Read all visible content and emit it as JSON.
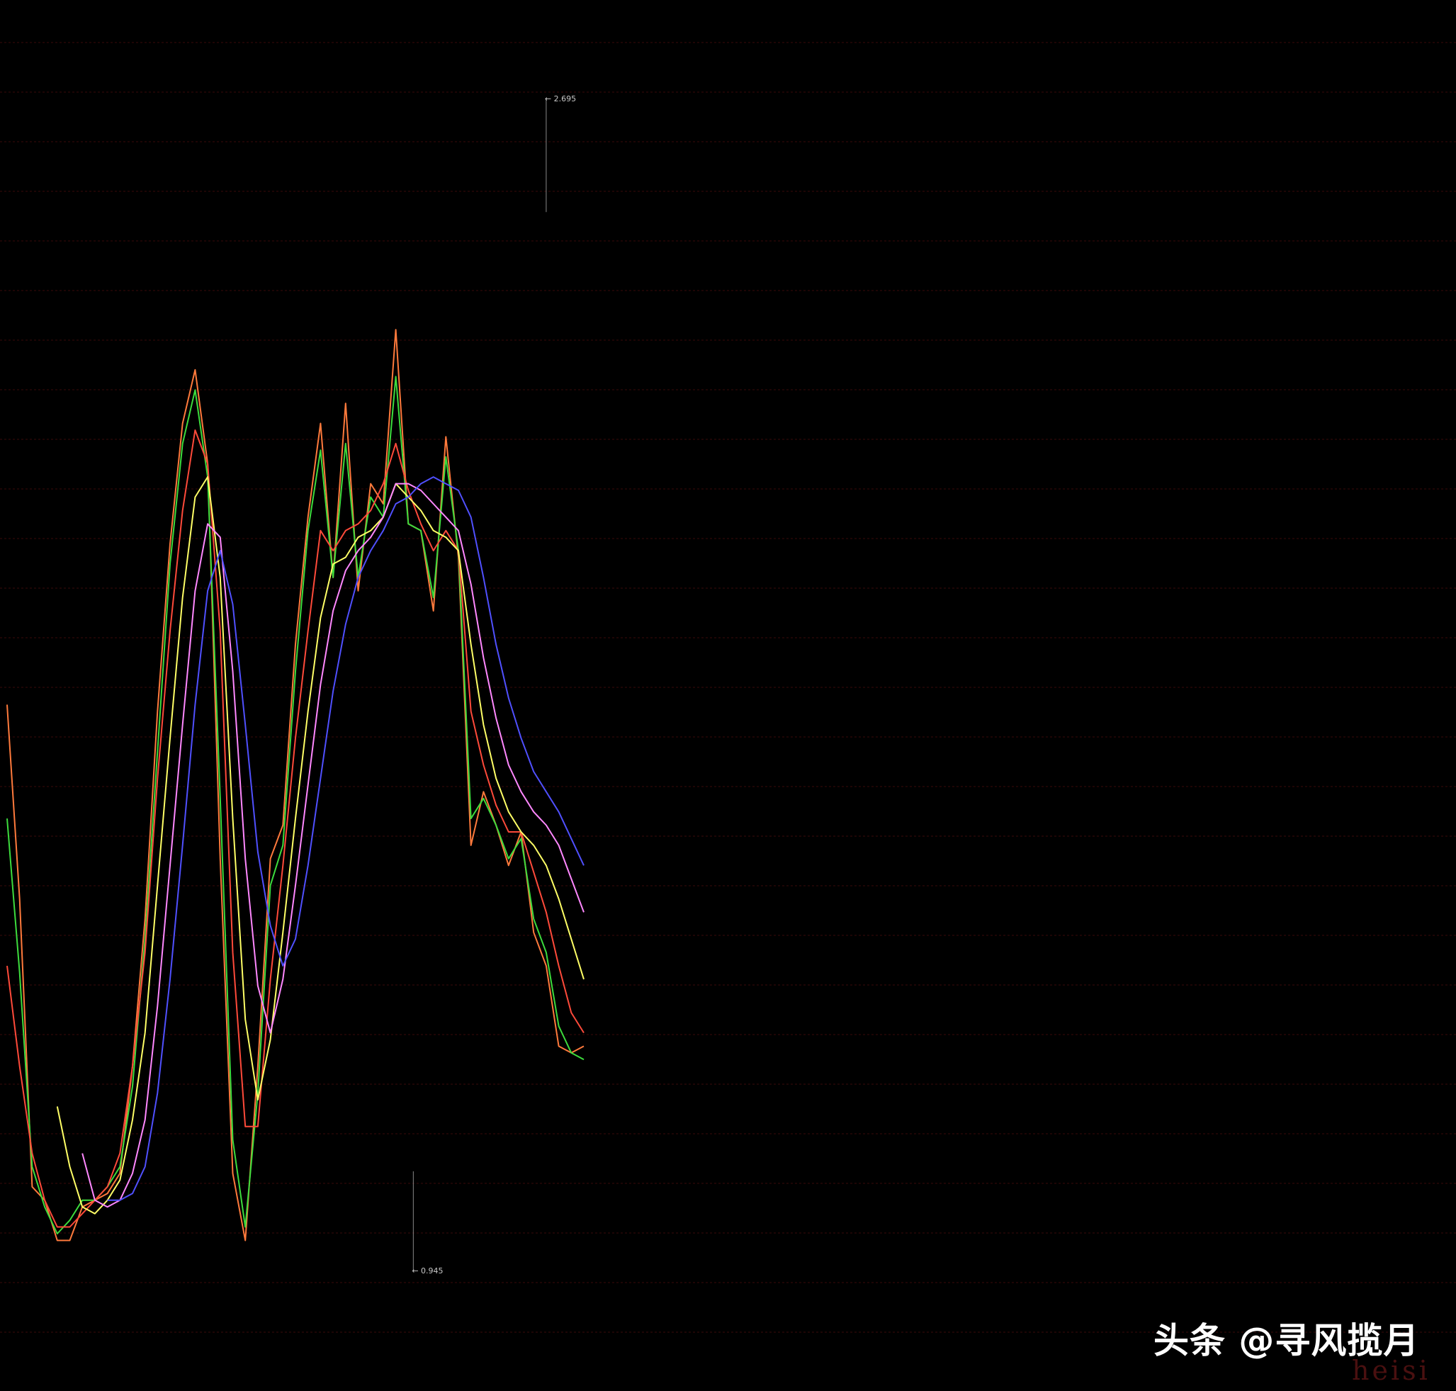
{
  "chart_data": {
    "type": "line",
    "title": "",
    "xlabel": "",
    "ylabel": "",
    "ylim": [
      0.8,
      2.8
    ],
    "grid": true,
    "gridColor": "#3a0a0a",
    "background": "#000000",
    "annotations": {
      "high": {
        "label": "← 2.695",
        "value": 2.695,
        "x": 215
      },
      "low": {
        "label": "← 0.945",
        "value": 0.945,
        "x": 162
      }
    },
    "x": [
      0,
      5,
      10,
      15,
      20,
      25,
      30,
      35,
      40,
      45,
      50,
      55,
      60,
      65,
      70,
      75,
      80,
      85,
      90,
      95,
      100,
      105,
      110,
      115,
      120,
      125,
      130,
      135,
      140,
      145,
      150,
      155,
      160,
      165,
      170,
      175,
      180,
      185,
      190,
      195,
      200,
      205,
      210,
      215,
      220,
      225,
      230,
      235,
      240,
      245,
      250,
      255,
      260,
      265,
      270,
      275,
      280,
      285,
      290,
      295,
      300,
      305,
      310,
      315,
      320,
      325,
      330,
      335,
      340,
      345,
      350,
      355,
      360,
      365,
      370,
      375,
      380,
      385,
      390
    ],
    "series": [
      {
        "color": "#ff7a3c",
        "values": [
          1.79,
          1.5,
          1.07,
          1.05,
          0.99,
          0.99,
          1.04,
          1.05,
          1.06,
          1.09,
          1.25,
          1.47,
          1.78,
          2.03,
          2.21,
          2.29,
          2.15,
          1.56,
          1.09,
          0.99,
          1.25,
          1.56,
          1.61,
          1.88,
          2.07,
          2.21,
          1.98,
          2.24,
          1.96,
          2.12,
          2.09,
          2.35,
          2.06,
          2.05,
          1.93,
          2.19,
          2.01,
          1.58,
          1.66,
          1.61,
          1.55,
          1.6,
          1.45,
          1.4,
          1.28,
          1.27,
          1.28
        ]
      },
      {
        "color": "#3ddc3d",
        "values": [
          1.62,
          1.39,
          1.1,
          1.04,
          1.0,
          1.02,
          1.05,
          1.05,
          1.07,
          1.1,
          1.22,
          1.44,
          1.72,
          2.0,
          2.18,
          2.26,
          2.13,
          1.65,
          1.14,
          1.01,
          1.21,
          1.52,
          1.58,
          1.84,
          2.05,
          2.17,
          1.98,
          2.18,
          1.98,
          2.1,
          2.07,
          2.28,
          2.06,
          2.05,
          1.95,
          2.16,
          2.02,
          1.62,
          1.65,
          1.61,
          1.56,
          1.59,
          1.47,
          1.42,
          1.31,
          1.27,
          1.26
        ]
      },
      {
        "color": "#ff4a3a",
        "values": [
          1.4,
          1.25,
          1.12,
          1.05,
          1.01,
          1.01,
          1.03,
          1.05,
          1.07,
          1.12,
          1.25,
          1.42,
          1.68,
          1.9,
          2.08,
          2.2,
          2.15,
          1.9,
          1.42,
          1.16,
          1.16,
          1.38,
          1.55,
          1.74,
          1.9,
          2.05,
          2.02,
          2.05,
          2.06,
          2.08,
          2.12,
          2.18,
          2.11,
          2.06,
          2.02,
          2.05,
          2.02,
          1.78,
          1.7,
          1.64,
          1.6,
          1.6,
          1.54,
          1.48,
          1.4,
          1.33,
          1.3
        ]
      },
      {
        "color": "#ffff66",
        "values": [
          null,
          null,
          null,
          null,
          1.19,
          1.1,
          1.04,
          1.03,
          1.05,
          1.08,
          1.17,
          1.3,
          1.52,
          1.74,
          1.95,
          2.1,
          2.13,
          1.98,
          1.62,
          1.32,
          1.2,
          1.29,
          1.45,
          1.62,
          1.78,
          1.92,
          2.0,
          2.01,
          2.04,
          2.05,
          2.07,
          2.12,
          2.1,
          2.08,
          2.05,
          2.04,
          2.02,
          1.88,
          1.76,
          1.68,
          1.63,
          1.6,
          1.58,
          1.55,
          1.5,
          1.44,
          1.38
        ]
      },
      {
        "color": "#ff88ff",
        "values": [
          null,
          null,
          null,
          null,
          null,
          null,
          1.12,
          1.05,
          1.04,
          1.05,
          1.09,
          1.17,
          1.34,
          1.55,
          1.76,
          1.96,
          2.06,
          2.04,
          1.84,
          1.56,
          1.37,
          1.3,
          1.38,
          1.52,
          1.67,
          1.82,
          1.93,
          1.99,
          2.02,
          2.04,
          2.07,
          2.12,
          2.12,
          2.11,
          2.09,
          2.07,
          2.05,
          1.97,
          1.86,
          1.77,
          1.7,
          1.66,
          1.63,
          1.61,
          1.58,
          1.53,
          1.48
        ]
      },
      {
        "color": "#5050ff",
        "values": [
          null,
          null,
          null,
          null,
          null,
          null,
          null,
          null,
          1.05,
          1.05,
          1.06,
          1.1,
          1.21,
          1.38,
          1.58,
          1.79,
          1.96,
          2.02,
          1.94,
          1.76,
          1.57,
          1.46,
          1.4,
          1.44,
          1.55,
          1.68,
          1.81,
          1.91,
          1.98,
          2.02,
          2.05,
          2.09,
          2.1,
          2.12,
          2.13,
          2.12,
          2.11,
          2.07,
          1.98,
          1.88,
          1.8,
          1.74,
          1.69,
          1.66,
          1.63,
          1.59,
          1.55
        ]
      }
    ]
  },
  "watermark": {
    "text": "头条 @寻风揽月"
  },
  "corner_mark": {
    "text": "heisi"
  }
}
